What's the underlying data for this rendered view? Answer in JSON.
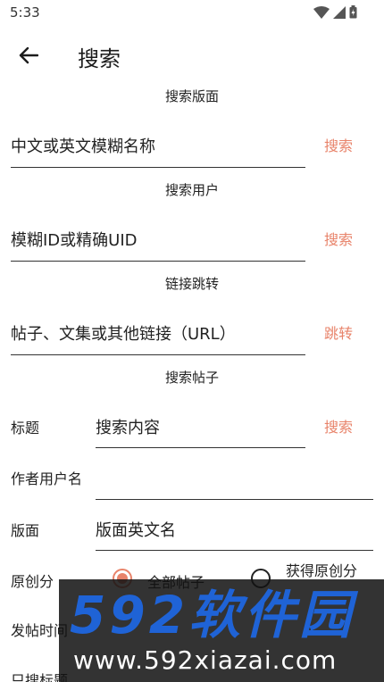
{
  "status_bar": {
    "time": "5:33",
    "icons": [
      "wifi-icon",
      "signal-icon",
      "battery-icon"
    ]
  },
  "app_bar": {
    "title": "搜索",
    "back_icon": "arrow-left-icon"
  },
  "sections": {
    "board": {
      "title": "搜索版面",
      "placeholder": "中文或英文模糊名称",
      "action": "搜索"
    },
    "user": {
      "title": "搜索用户",
      "placeholder": "模糊ID或精确UID",
      "action": "搜索"
    },
    "link": {
      "title": "链接跳转",
      "placeholder": "帖子、文集或其他链接（URL）",
      "action": "跳转"
    },
    "post": {
      "title": "搜索帖子",
      "fields": {
        "title_label": "标题",
        "title_placeholder": "搜索内容",
        "author_label": "作者用户名",
        "author_placeholder": "",
        "board_label": "版面",
        "board_placeholder": "版面英文名",
        "original_label": "原创分",
        "original_options": [
          "全部帖子",
          "获得原创分"
        ],
        "time_label": "发帖时间",
        "only_label": "只搜标题"
      },
      "action": "搜索"
    }
  },
  "watermark": {
    "logo": "592软件园",
    "url": "www.592xiazai.com"
  },
  "colors": {
    "accent": "#e8836a",
    "text": "#222222",
    "watermark_blue": "#1f63d6"
  }
}
